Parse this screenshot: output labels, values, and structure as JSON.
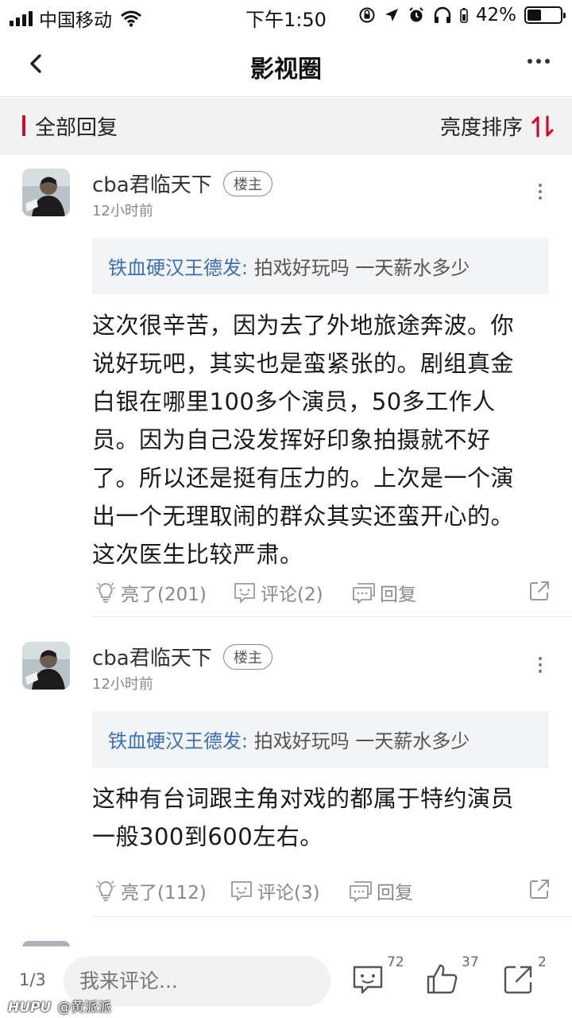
{
  "status_bar": {
    "carrier": "中国移动",
    "time": "下午1:50",
    "battery": "42%",
    "battery_level": 0.42
  },
  "nav": {
    "title": "影视圈"
  },
  "filter": {
    "all_replies": "全部回复",
    "sort_label": "亮度排序"
  },
  "posts": [
    {
      "username": "cba君临天下",
      "badge": "楼主",
      "time": "12小时前",
      "quote_author": "铁血硬汉王德发:",
      "quote_text": "拍戏好玩吗 一天薪水多少",
      "body_lines": [
        "这次很辛苦，因为去了外地旅途奔波。你",
        "说好玩吧，其实也是蛮紧张的。剧组真金",
        "白银在哪里100多个演员，50多工作人",
        "员。因为自己没发挥好印象拍摄就不好",
        "了。所以还是挺有压力的。上次是一个演",
        "出一个无理取闹的群众其实还蛮开心的。",
        "这次医生比较严肃。"
      ],
      "like_label": "亮了(201)",
      "comment_label": "评论(2)",
      "reply_label": "回复"
    },
    {
      "username": "cba君临天下",
      "badge": "楼主",
      "time": "12小时前",
      "quote_author": "铁血硬汉王德发:",
      "quote_text": "拍戏好玩吗 一天薪水多少",
      "body_lines": [
        "这种有台词跟主角对戏的都属于特约演员",
        "一般300到600左右。"
      ],
      "like_label": "亮了(112)",
      "comment_label": "评论(3)",
      "reply_label": "回复"
    }
  ],
  "bottom_bar": {
    "page_indicator": "1/3",
    "comment_placeholder": "我来评论...",
    "comment_count": "72",
    "like_count": "37",
    "share_count": "2"
  },
  "watermark": {
    "logo": "HUPU",
    "handle": "@黄派派"
  }
}
